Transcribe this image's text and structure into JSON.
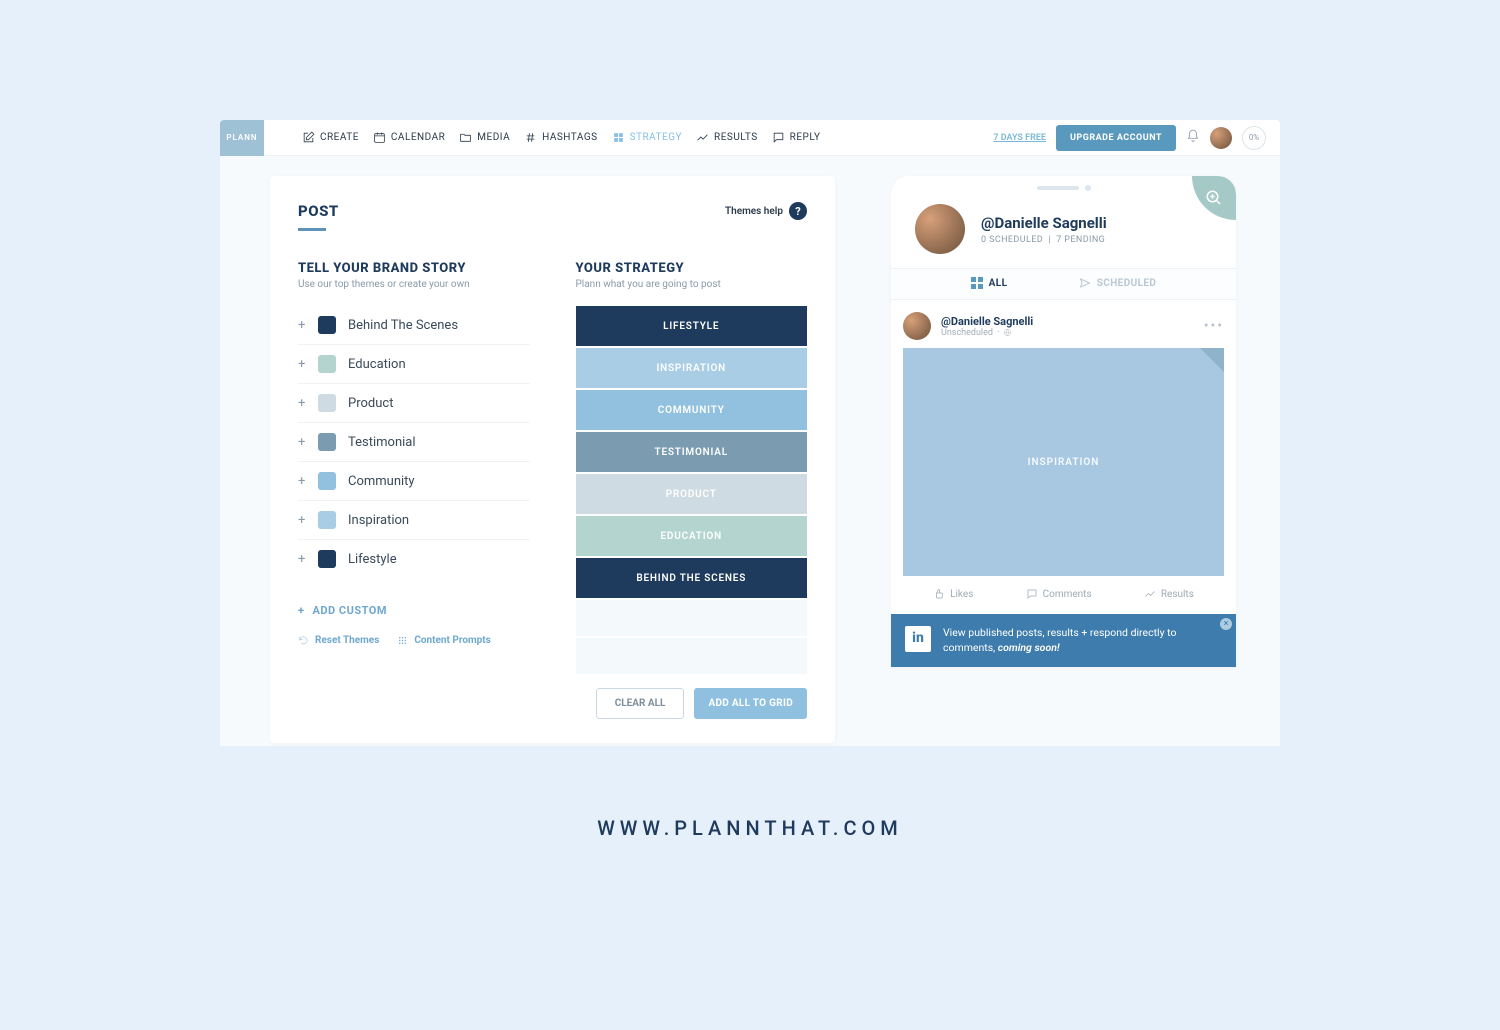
{
  "logo": "PLANN",
  "nav": [
    {
      "label": "CREATE"
    },
    {
      "label": "CALENDAR"
    },
    {
      "label": "MEDIA"
    },
    {
      "label": "HASHTAGS"
    },
    {
      "label": "STRATEGY"
    },
    {
      "label": "RESULTS"
    },
    {
      "label": "REPLY"
    }
  ],
  "trial": "7 DAYS FREE",
  "upgrade": "UPGRADE ACCOUNT",
  "progress": "0%",
  "post": {
    "title": "POST",
    "help": "Themes help",
    "left": {
      "title": "TELL YOUR BRAND STORY",
      "sub": "Use our top themes or create your own"
    },
    "right": {
      "title": "YOUR STRATEGY",
      "sub": "Plann what you are going to post"
    },
    "themes": [
      {
        "label": "Behind The Scenes",
        "color": "#1e3a5c"
      },
      {
        "label": "Education",
        "color": "#b4d5cf"
      },
      {
        "label": "Product",
        "color": "#cfdbe2"
      },
      {
        "label": "Testimonial",
        "color": "#7a9bb0"
      },
      {
        "label": "Community",
        "color": "#92c1df"
      },
      {
        "label": "Inspiration",
        "color": "#a8cde4"
      },
      {
        "label": "Lifestyle",
        "color": "#1e3a5c"
      }
    ],
    "add_custom": "ADD CUSTOM",
    "reset": "Reset Themes",
    "prompts": "Content Prompts",
    "strategy": [
      {
        "label": "LIFESTYLE",
        "bg": "#1e3a5c"
      },
      {
        "label": "INSPIRATION",
        "bg": "#a8cde4"
      },
      {
        "label": "COMMUNITY",
        "bg": "#92c1df"
      },
      {
        "label": "TESTIMONIAL",
        "bg": "#7a9bb0"
      },
      {
        "label": "PRODUCT",
        "bg": "#cfdbe2"
      },
      {
        "label": "EDUCATION",
        "bg": "#b4d5cf"
      },
      {
        "label": "BEHIND THE SCENES",
        "bg": "#1e3a5c"
      }
    ],
    "clear": "CLEAR ALL",
    "add_all": "ADD ALL TO GRID"
  },
  "phone": {
    "handle": "@Danielle Sagnelli",
    "stats_scheduled": "0 SCHEDULED",
    "stats_pending": "7 PENDING",
    "tab_all": "ALL",
    "tab_scheduled": "SCHEDULED",
    "post_handle": "@Danielle Sagnelli",
    "post_status": "Unscheduled",
    "tile_label": "INSPIRATION",
    "likes": "Likes",
    "comments": "Comments",
    "results": "Results",
    "banner_text": "View published posts, results + respond directly to comments, ",
    "banner_em": "coming soon!"
  },
  "footer": "WWW.PLANNTHAT.COM"
}
